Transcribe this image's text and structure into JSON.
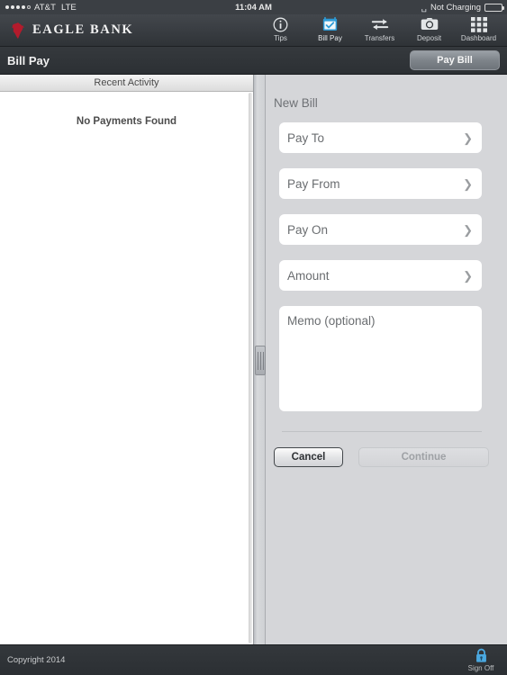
{
  "status_bar": {
    "signal_dots_filled": 4,
    "signal_dots_total": 5,
    "carrier": "AT&T",
    "network": "LTE",
    "time": "11:04 AM",
    "bluetooth_icon": "bluetooth-icon",
    "battery_status": "Not Charging",
    "battery_icon": "battery-icon"
  },
  "navbar": {
    "logo_icon": "eagle-logo-icon",
    "brand": "EAGLE BANK",
    "brand_color": "#b31b2c",
    "active_color": "#2e9bd6",
    "items": [
      {
        "label": "Tips",
        "icon": "info-circle-icon",
        "active": false
      },
      {
        "label": "Bill Pay",
        "icon": "calendar-check-icon",
        "active": true
      },
      {
        "label": "Transfers",
        "icon": "transfer-arrows-icon",
        "active": false
      },
      {
        "label": "Deposit",
        "icon": "camera-icon",
        "active": false
      },
      {
        "label": "Dashboard",
        "icon": "grid-icon",
        "active": false
      }
    ]
  },
  "subheader": {
    "title": "Bill Pay",
    "pay_bill_label": "Pay Bill"
  },
  "left_panel": {
    "header": "Recent Activity",
    "empty_message": "No Payments Found"
  },
  "right_panel": {
    "section_title": "New Bill",
    "rows": [
      {
        "label": "Pay To",
        "chevron": "chevron-right-icon"
      },
      {
        "label": "Pay From",
        "chevron": "chevron-right-icon"
      },
      {
        "label": "Pay On",
        "chevron": "chevron-right-icon"
      },
      {
        "label": "Amount",
        "chevron": "chevron-right-icon"
      }
    ],
    "memo_placeholder": "Memo (optional)",
    "memo_value": "",
    "cancel_label": "Cancel",
    "continue_label": "Continue"
  },
  "footer": {
    "copyright": "Copyright 2014",
    "signoff_label": "Sign Off",
    "signoff_icon": "lock-icon",
    "signoff_icon_color": "#4aa8e0"
  }
}
